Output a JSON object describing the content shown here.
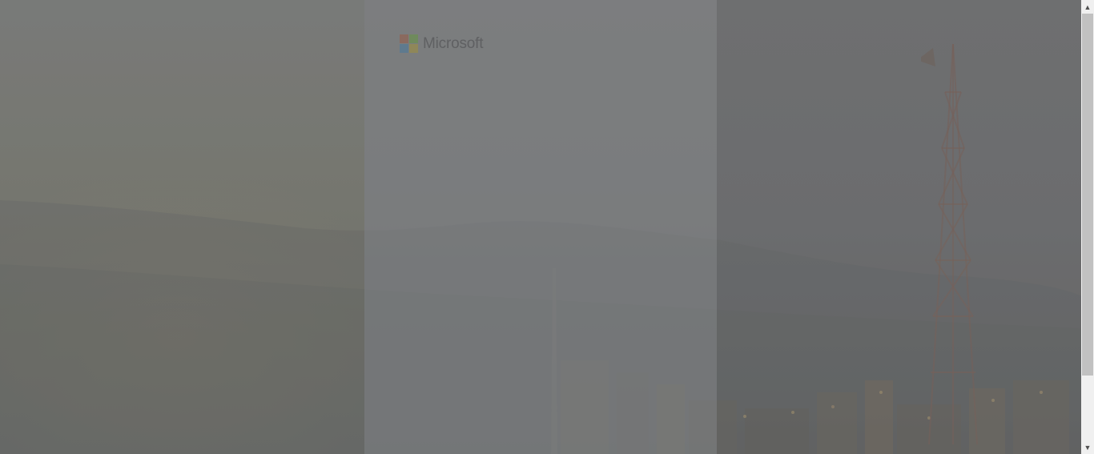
{
  "brand": {
    "name": "Microsoft",
    "logo_colors": [
      "#f25022",
      "#7fba00",
      "#00a4ef",
      "#ffb900"
    ]
  },
  "scrollbar": {
    "up_icon": "triangle-up",
    "down_icon": "triangle-down"
  }
}
